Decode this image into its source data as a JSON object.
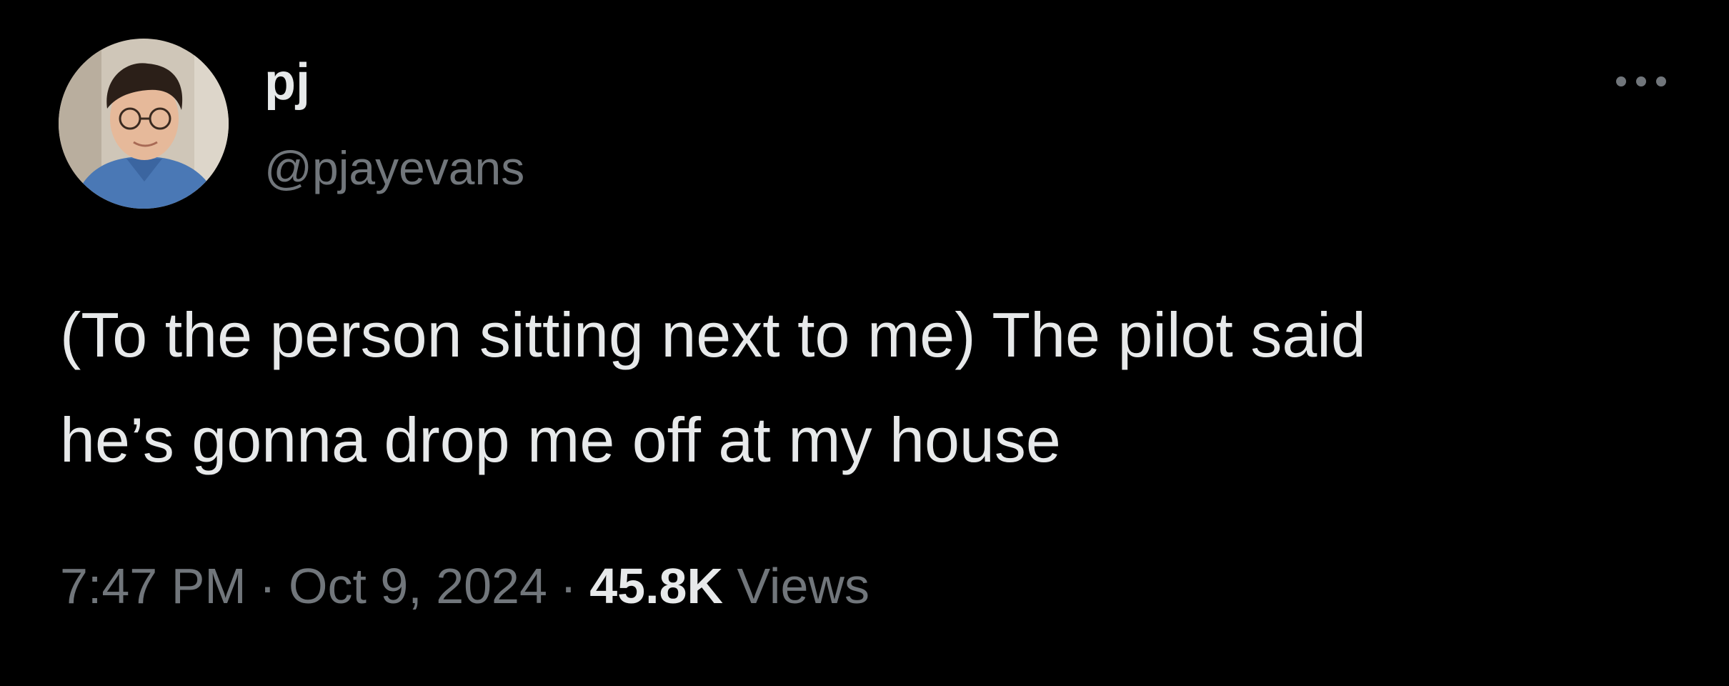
{
  "tweet": {
    "author": {
      "display_name": "pj",
      "handle": "@pjayevans",
      "avatar_icon": "profile-photo"
    },
    "more_icon": "more-horizontal-icon",
    "text_lines": [
      "(To the person sitting next to me) The pilot said",
      "he’s gonna drop me off at my house"
    ],
    "meta": {
      "time": "7:47 PM",
      "separator": "·",
      "date": "Oct 9, 2024",
      "views_count": "45.8K",
      "views_label": "Views"
    }
  },
  "colors": {
    "background": "#000000",
    "primary_text": "#e7e9ea",
    "secondary_text": "#71767b"
  }
}
